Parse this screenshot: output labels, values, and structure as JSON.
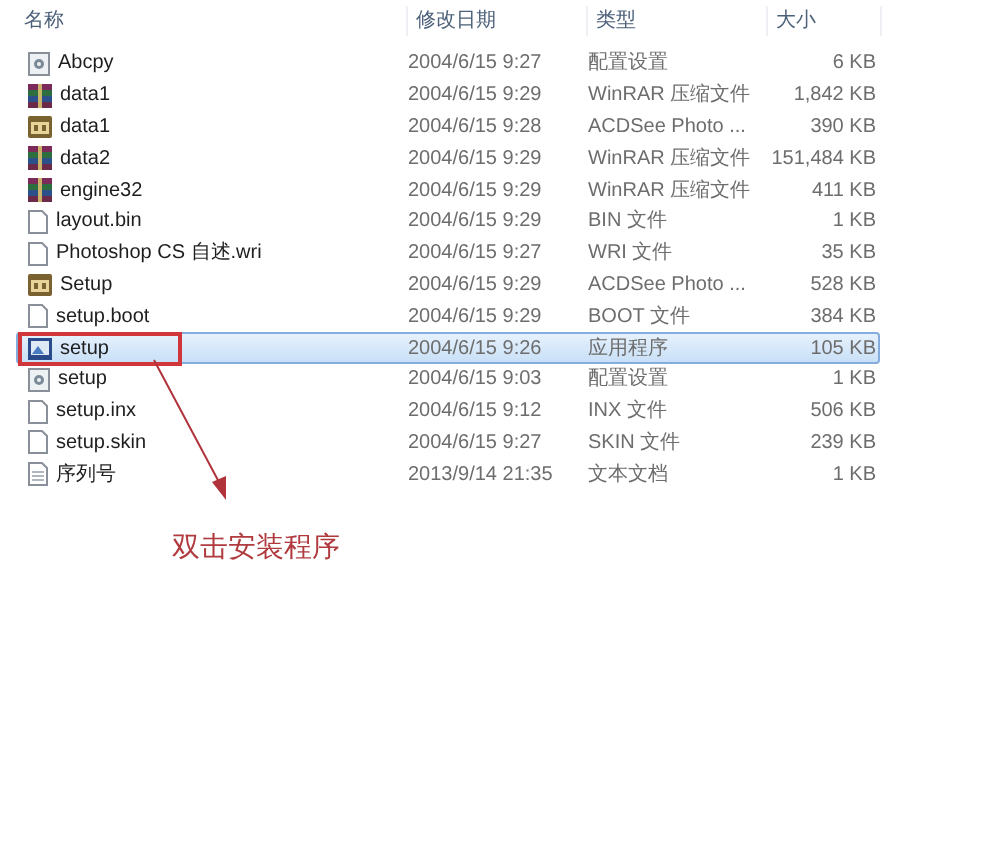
{
  "columns": [
    "名称",
    "修改日期",
    "类型",
    "大小"
  ],
  "rows": [
    {
      "name": "Abcpy",
      "date": "2004/6/15 9:27",
      "type": "配置设置",
      "size": "6 KB",
      "kind": "config",
      "selected": false,
      "annotated": false
    },
    {
      "name": "data1",
      "date": "2004/6/15 9:29",
      "type": "WinRAR 压缩文件",
      "size": "1,842 KB",
      "kind": "archive",
      "selected": false,
      "annotated": false
    },
    {
      "name": "data1",
      "date": "2004/6/15 9:28",
      "type": "ACDSee Photo ...",
      "size": "390 KB",
      "kind": "image",
      "selected": false,
      "annotated": false
    },
    {
      "name": "data2",
      "date": "2004/6/15 9:29",
      "type": "WinRAR 压缩文件",
      "size": "151,484 KB",
      "kind": "archive",
      "selected": false,
      "annotated": false
    },
    {
      "name": "engine32",
      "date": "2004/6/15 9:29",
      "type": "WinRAR 压缩文件",
      "size": "411 KB",
      "kind": "archive",
      "selected": false,
      "annotated": false
    },
    {
      "name": "layout.bin",
      "date": "2004/6/15 9:29",
      "type": "BIN 文件",
      "size": "1 KB",
      "kind": "file",
      "selected": false,
      "annotated": false
    },
    {
      "name": "Photoshop CS 自述.wri",
      "date": "2004/6/15 9:27",
      "type": "WRI 文件",
      "size": "35 KB",
      "kind": "file",
      "selected": false,
      "annotated": false
    },
    {
      "name": "Setup",
      "date": "2004/6/15 9:29",
      "type": "ACDSee Photo ...",
      "size": "528 KB",
      "kind": "image",
      "selected": false,
      "annotated": false
    },
    {
      "name": "setup.boot",
      "date": "2004/6/15 9:29",
      "type": "BOOT 文件",
      "size": "384 KB",
      "kind": "file",
      "selected": false,
      "annotated": false
    },
    {
      "name": "setup",
      "date": "2004/6/15 9:26",
      "type": "应用程序",
      "size": "105 KB",
      "kind": "app",
      "selected": true,
      "annotated": true
    },
    {
      "name": "setup",
      "date": "2004/6/15 9:03",
      "type": "配置设置",
      "size": "1 KB",
      "kind": "config",
      "selected": false,
      "annotated": false
    },
    {
      "name": "setup.inx",
      "date": "2004/6/15 9:12",
      "type": "INX 文件",
      "size": "506 KB",
      "kind": "file",
      "selected": false,
      "annotated": false
    },
    {
      "name": "setup.skin",
      "date": "2004/6/15 9:27",
      "type": "SKIN 文件",
      "size": "239 KB",
      "kind": "file",
      "selected": false,
      "annotated": false
    },
    {
      "name": "序列号",
      "date": "2013/9/14 21:35",
      "type": "文本文档",
      "size": "1 KB",
      "kind": "text",
      "selected": false,
      "annotated": false
    }
  ],
  "annotation": "双击安装程序"
}
